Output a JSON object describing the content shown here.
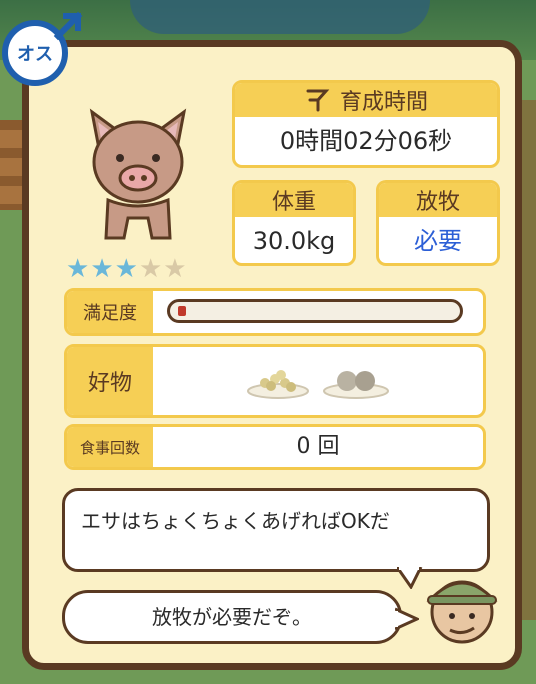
{
  "gender": {
    "label": "オス",
    "color": "#1f5fae"
  },
  "rating": {
    "stars_filled": 3,
    "stars_total": 5,
    "filled_color": "#6ab7d9"
  },
  "growth_time": {
    "label": "育成時間",
    "value": "0時間02分06秒",
    "icon": "hourglass-icon"
  },
  "weight": {
    "label": "体重",
    "value": "30.0kg"
  },
  "grazing": {
    "label": "放牧",
    "value": "必要",
    "value_color": "#2c5fd6"
  },
  "satisfaction": {
    "label": "満足度",
    "level_percent": 3
  },
  "favorite_food": {
    "label": "好物",
    "items": [
      "grain-bowl-icon",
      "meatball-plate-icon"
    ]
  },
  "meal_count": {
    "label": "食事回数",
    "value": "0 回"
  },
  "dialog": {
    "line1": "エサはちょくちょくあげればOKだ",
    "line2": "放牧が必要だぞ。"
  }
}
